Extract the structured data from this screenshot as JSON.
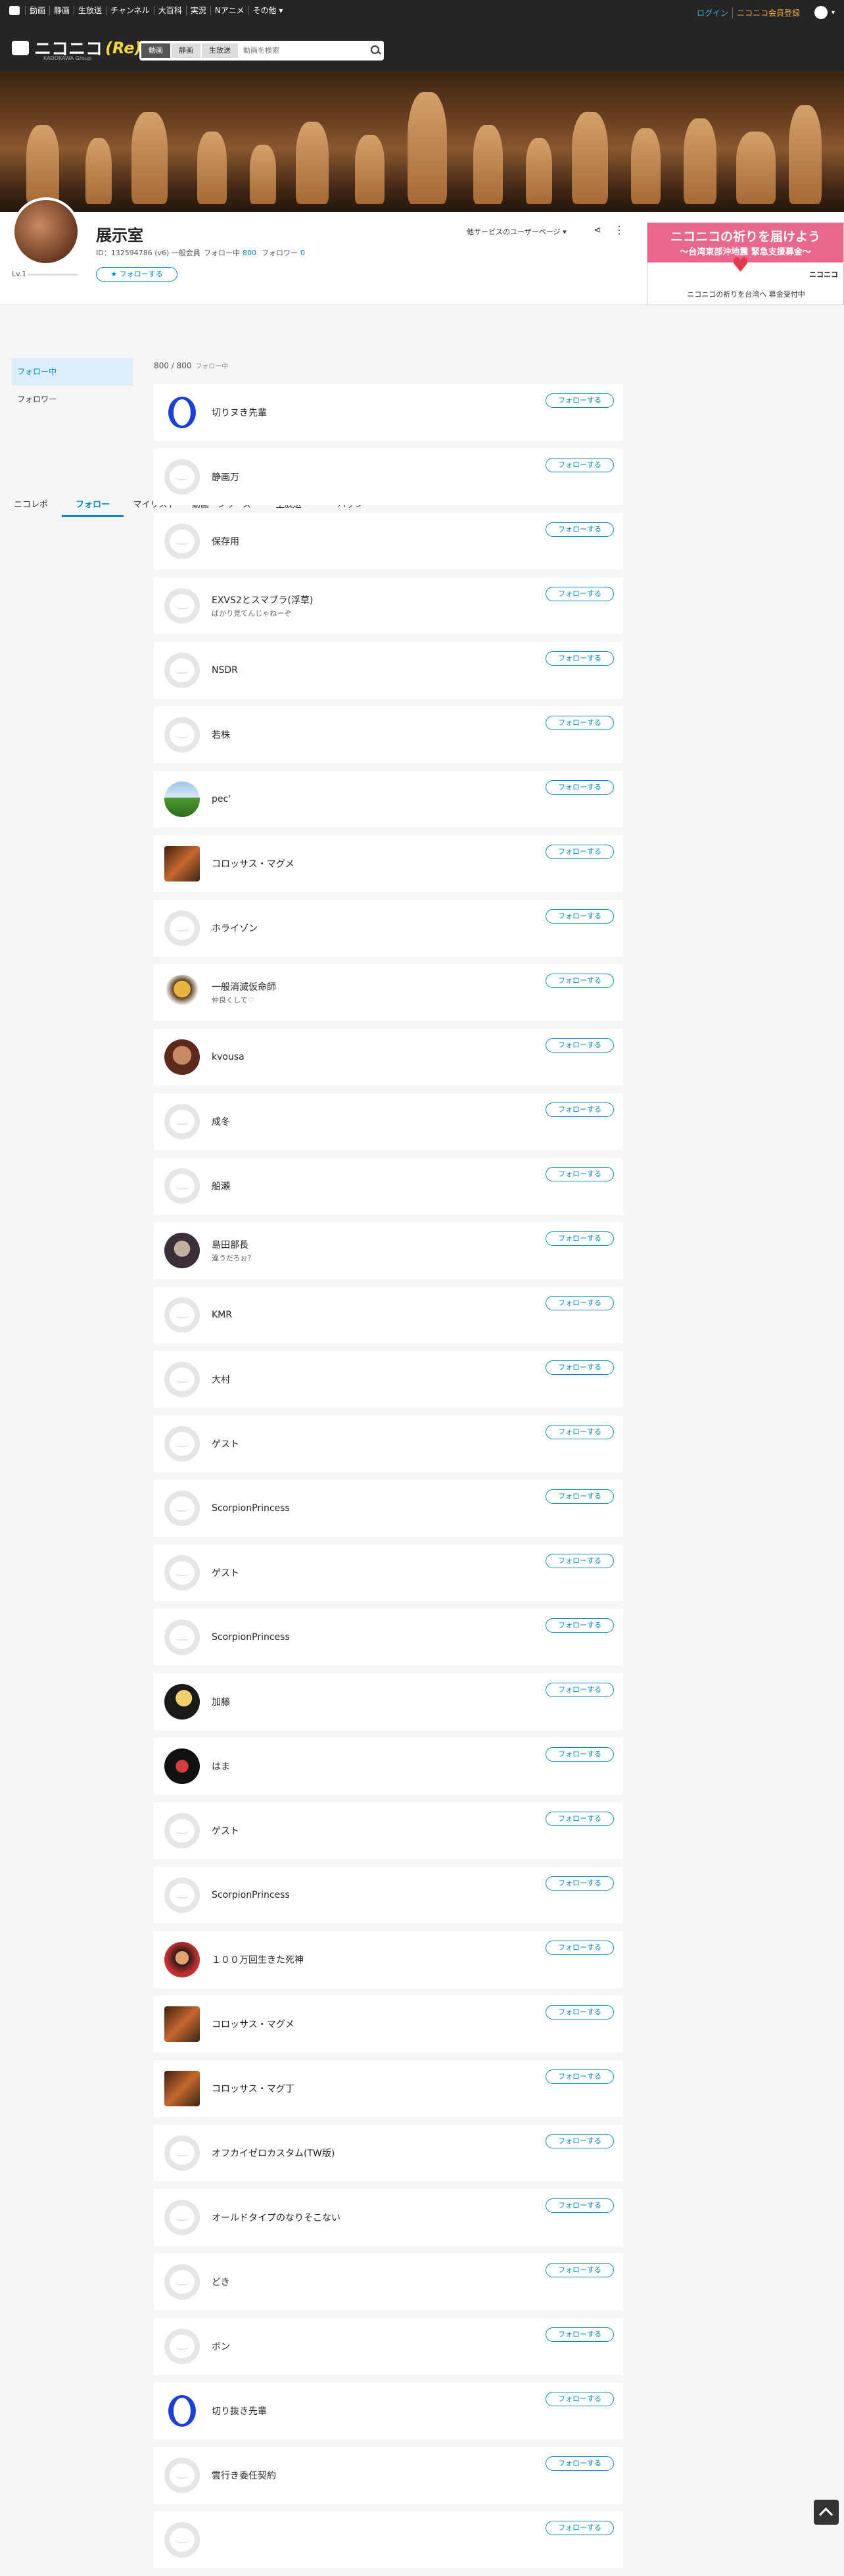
{
  "topnav": {
    "items": [
      "動画",
      "静画",
      "生放送",
      "チャンネル",
      "大百科",
      "実況",
      "Nアニメ",
      "その他"
    ],
    "login": "ログイン",
    "register": "ニコニコ会員登録"
  },
  "header": {
    "logo_text": "ニコニコ",
    "logo_er": "(Re)",
    "logo_sub": "KADOKAWA Group",
    "search_tabs": [
      "動画",
      "静画",
      "生放送"
    ],
    "search_placeholder": "動画を検索"
  },
  "profile": {
    "name": "展示室",
    "info": "ID：132594786 (v6) 一般会員",
    "following_label": "フォロー中",
    "following_count": "800",
    "follower_label": "フォロワー",
    "follower_count": "0",
    "level": "Lv.1",
    "follow_button": "フォローする",
    "service_menu": "他サービスのユーザーページ",
    "tabs": [
      "ニコレポ",
      "フォロー",
      "マイリスト",
      "動画・シリーズ",
      "生放送",
      "バッジ"
    ]
  },
  "ad": {
    "line1": "ニコニコの祈りを届けよう",
    "line2": "～台湾東部沖地震 緊急支援募金～",
    "brand": "ニコニコ",
    "caption": "ニコニコの祈りを台湾へ 募金受付中"
  },
  "sidebar": {
    "items": [
      "フォロー中",
      "フォロワー"
    ]
  },
  "list": {
    "count": "800 / 800",
    "count_label": "フォロー中",
    "follow_label": "フォローする",
    "users": [
      {
        "name": "切りヌき先輩",
        "desc": "",
        "avatar": "blue"
      },
      {
        "name": "静画万",
        "desc": "",
        "avatar": "default"
      },
      {
        "name": "保存用",
        "desc": "",
        "avatar": "default"
      },
      {
        "name": "EXVS2とスマブラ(浮草)",
        "desc": "ばかり見てんじゃねーぞ",
        "avatar": "default"
      },
      {
        "name": "NSDR",
        "desc": "",
        "avatar": "default"
      },
      {
        "name": "若株",
        "desc": "",
        "avatar": "default"
      },
      {
        "name": "pec'",
        "desc": "",
        "avatar": "field"
      },
      {
        "name": "コロッサス・マグメ",
        "desc": "",
        "avatar": "game"
      },
      {
        "name": "ホライゾン",
        "desc": "",
        "avatar": "default"
      },
      {
        "name": "一般消滅仮命師",
        "desc": "仲良くして♡",
        "avatar": "figure"
      },
      {
        "name": "kvousa",
        "desc": "",
        "avatar": "face"
      },
      {
        "name": "成冬",
        "desc": "",
        "avatar": "default"
      },
      {
        "name": "船瀬",
        "desc": "",
        "avatar": "default"
      },
      {
        "name": "島田部長",
        "desc": "違うだろぉ？",
        "avatar": "dark"
      },
      {
        "name": "KMR",
        "desc": "",
        "avatar": "default"
      },
      {
        "name": "大村",
        "desc": "",
        "avatar": "default"
      },
      {
        "name": "ゲスト",
        "desc": "",
        "avatar": "default"
      },
      {
        "name": "ScorpionPrincess",
        "desc": "",
        "avatar": "default"
      },
      {
        "name": "ゲスト",
        "desc": "",
        "avatar": "default"
      },
      {
        "name": "ScorpionPrincess",
        "desc": "",
        "avatar": "default"
      },
      {
        "name": "加藤",
        "desc": "",
        "avatar": "anime"
      },
      {
        "name": "はま",
        "desc": "",
        "avatar": "hamu"
      },
      {
        "name": "ゲスト",
        "desc": "",
        "avatar": "default"
      },
      {
        "name": "ScorpionPrincess",
        "desc": "",
        "avatar": "default"
      },
      {
        "name": "１００万回生きた死神",
        "desc": "",
        "avatar": "red"
      },
      {
        "name": "コロッサス・マグメ",
        "desc": "",
        "avatar": "game"
      },
      {
        "name": "コロッサス・マグ丁",
        "desc": "",
        "avatar": "game"
      },
      {
        "name": "オフカイゼロカスタム(TW版)",
        "desc": "",
        "avatar": "default"
      },
      {
        "name": "オールドタイプのなりそこない",
        "desc": "",
        "avatar": "default"
      },
      {
        "name": "どき",
        "desc": "",
        "avatar": "default"
      },
      {
        "name": "ボン",
        "desc": "",
        "avatar": "default"
      },
      {
        "name": "切り抜き先輩",
        "desc": "",
        "avatar": "blue"
      },
      {
        "name": "雲行き委任契約",
        "desc": "",
        "avatar": "default"
      },
      {
        "name": "",
        "desc": "",
        "avatar": "default"
      }
    ]
  }
}
